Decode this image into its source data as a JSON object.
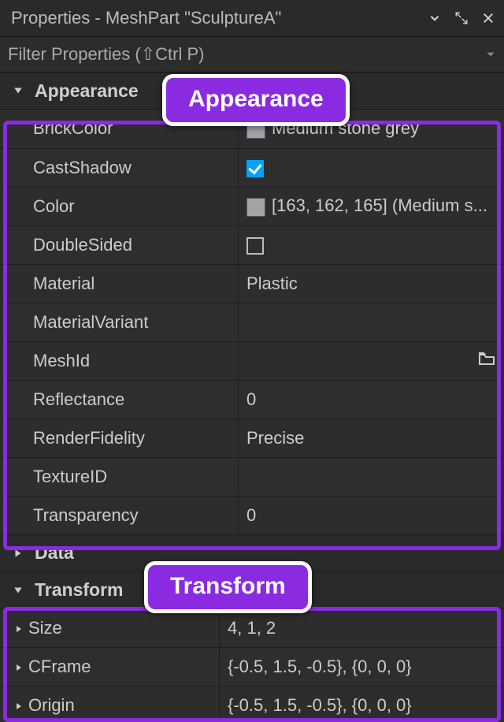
{
  "window": {
    "title": "Properties - MeshPart \"SculptureA\""
  },
  "filter": {
    "placeholder": "Filter Properties (⇧Ctrl P)"
  },
  "sections": {
    "appearance": {
      "label": "Appearance",
      "expanded": true,
      "rows": {
        "brickcolor": {
          "key": "BrickColor",
          "value": "Medium stone grey",
          "swatch": "#a3a2a5"
        },
        "castshadow": {
          "key": "CastShadow",
          "checked": true
        },
        "color": {
          "key": "Color",
          "value": "[163, 162, 165] (Medium s...",
          "swatch": "#a3a2a5"
        },
        "doublesided": {
          "key": "DoubleSided",
          "checked": false
        },
        "material": {
          "key": "Material",
          "value": "Plastic"
        },
        "materialvariant": {
          "key": "MaterialVariant",
          "value": ""
        },
        "meshid": {
          "key": "MeshId",
          "value": ""
        },
        "reflectance": {
          "key": "Reflectance",
          "value": "0"
        },
        "renderfidelity": {
          "key": "RenderFidelity",
          "value": "Precise"
        },
        "textureid": {
          "key": "TextureID",
          "value": ""
        },
        "transparency": {
          "key": "Transparency",
          "value": "0"
        }
      }
    },
    "data": {
      "label": "Data",
      "expanded": false
    },
    "transform": {
      "label": "Transform",
      "expanded": true,
      "rows": {
        "size": {
          "key": "Size",
          "value": "4, 1, 2"
        },
        "cframe": {
          "key": "CFrame",
          "value": "{-0.5, 1.5, -0.5}, {0, 0, 0}"
        },
        "origin": {
          "key": "Origin",
          "value": "{-0.5, 1.5, -0.5}, {0, 0, 0}"
        }
      }
    }
  },
  "callouts": {
    "appearance": "Appearance",
    "transform": "Transform"
  }
}
